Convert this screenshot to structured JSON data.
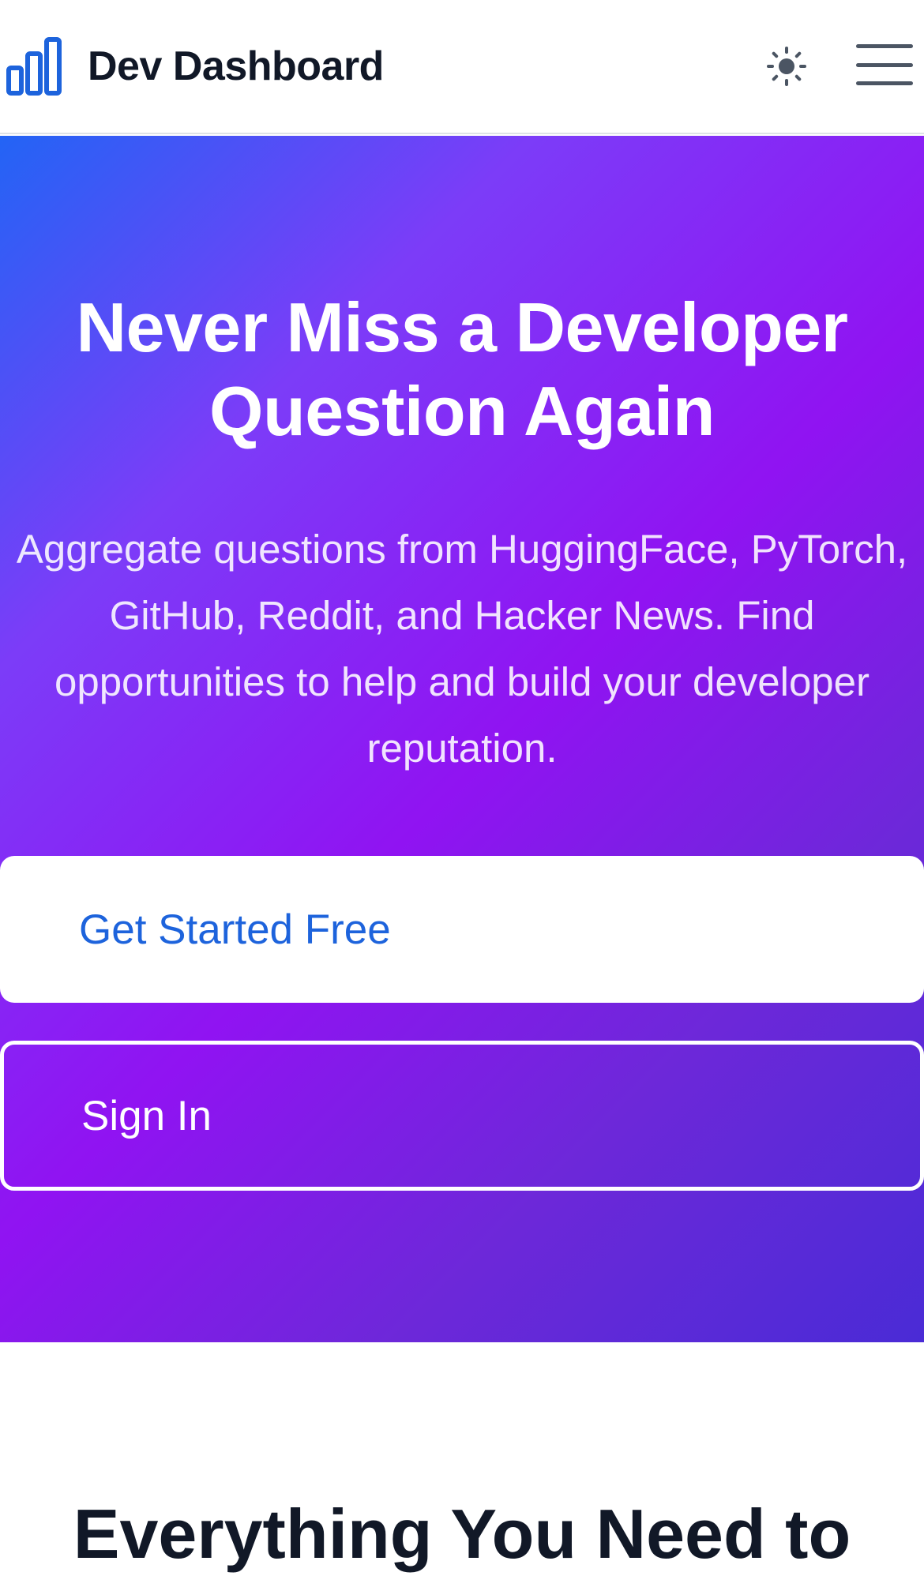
{
  "navbar": {
    "brand_name": "Dev Dashboard",
    "logo_icon": "bar-chart-icon",
    "theme_icon": "sun-icon",
    "menu_icon": "hamburger-menu-icon"
  },
  "hero": {
    "title": "Never Miss a Developer Question Again",
    "subtitle": "Aggregate questions from HuggingFace, PyTorch, GitHub, Reddit, and Hacker News. Find opportunities to help and build your developer reputation.",
    "primary_cta": "Get Started Free",
    "secondary_cta": "Sign In"
  },
  "features": {
    "title": "Everything You Need to"
  },
  "colors": {
    "brand_blue": "#1d63dc",
    "gradient_start": "#2364f5",
    "gradient_mid": "#9013f2",
    "gradient_end": "#4a2bd6",
    "text_dark": "#111827"
  }
}
